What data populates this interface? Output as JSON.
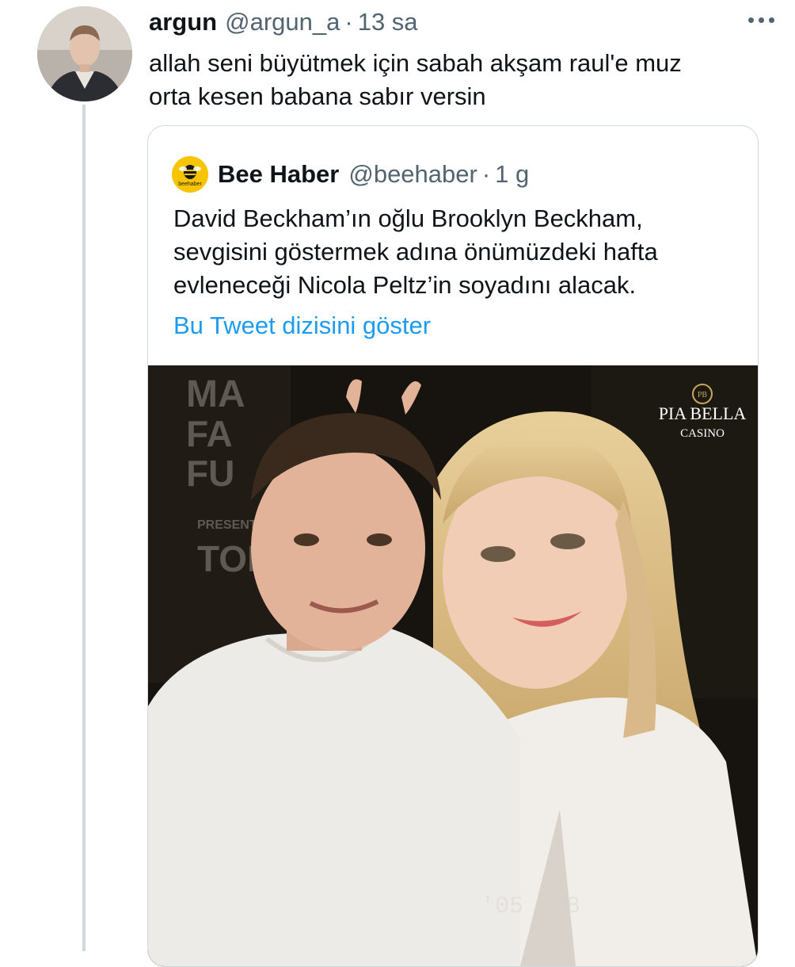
{
  "tweet": {
    "display_name": "argun",
    "handle": "@argun_a",
    "separator": "·",
    "time": "13 sa",
    "text_line1": "allah seni büyütmek için sabah akşam raul'e muz",
    "text_line2": "orta kesen babana sabır versin"
  },
  "quoted_tweet": {
    "display_name": "Bee Haber",
    "handle": "@beehaber",
    "separator": "·",
    "time": "1 g",
    "logo_text": "beehaber",
    "text_line1": "David Beckham’ın oğlu Brooklyn Beckham,",
    "text_line2": "sevgisini göstermek adına önümüzdeki hafta",
    "text_line3": "evleneceği Nicola Peltz’in soyadını alacak.",
    "show_thread_link": "Bu Tweet dizisini göster"
  },
  "photo": {
    "watermark_monogram": "PB",
    "watermark_line1": "PIA BELLA",
    "watermark_line2": "CASINO",
    "wall_text_1": "MA",
    "wall_text_2": "FA",
    "wall_text_3": "FU",
    "wall_text_4": "PRESENTED",
    "wall_text_5": "TOP",
    "date_stamp": "'05 3 8"
  },
  "colors": {
    "link": "#1d9bf0",
    "secondary_text": "#536471",
    "border": "#cfd9de",
    "bee_yellow": "#f7c400"
  }
}
